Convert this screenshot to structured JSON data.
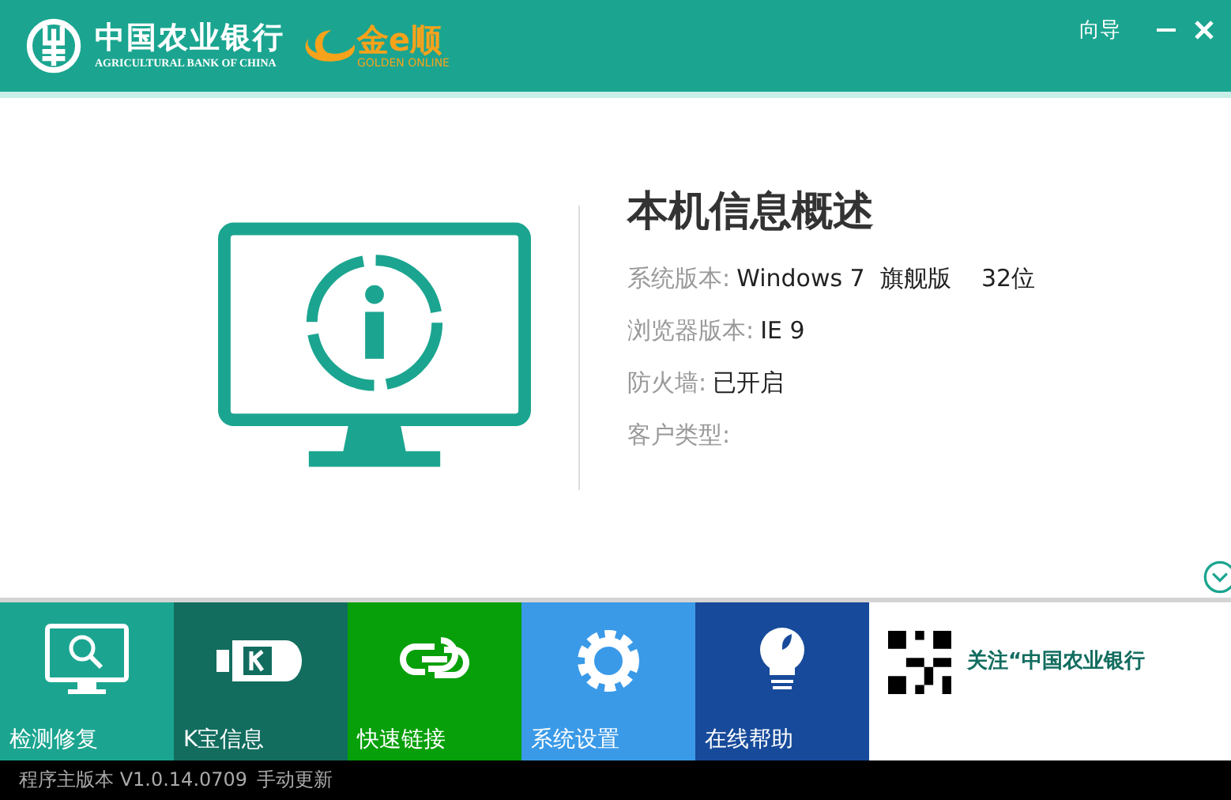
{
  "header": {
    "bank_name": "中国农业银行",
    "bank_name_en": "AGRICULTURAL BANK OF CHINA",
    "product_name": "金e顺",
    "product_name_en": "GOLDEN ONLINE",
    "guide_link": "向导"
  },
  "info": {
    "title": "本机信息概述",
    "rows": [
      {
        "label": "系统版本:",
        "value": "Windows 7  旗舰版    32位"
      },
      {
        "label": "浏览器版本:",
        "value": "IE 9"
      },
      {
        "label": "防火墙:",
        "value": "已开启"
      },
      {
        "label": "客户类型:"
      }
    ]
  },
  "tiles": [
    {
      "label": "检测修复",
      "kind": "monitor",
      "color": "#1ba590"
    },
    {
      "label": "K宝信息",
      "kind": "usbkey",
      "color": "#126d5f"
    },
    {
      "label": "快速链接",
      "kind": "link",
      "color": "#07a00a"
    },
    {
      "label": "系统设置",
      "kind": "gear",
      "color": "#3a9ae8"
    },
    {
      "label": "在线帮助",
      "kind": "bulb",
      "color": "#174a9a"
    }
  ],
  "promo": {
    "text": "关注“中国农业银行"
  },
  "status": {
    "version": "程序主版本 V1.0.14.0709",
    "update_link": "手动更新"
  }
}
